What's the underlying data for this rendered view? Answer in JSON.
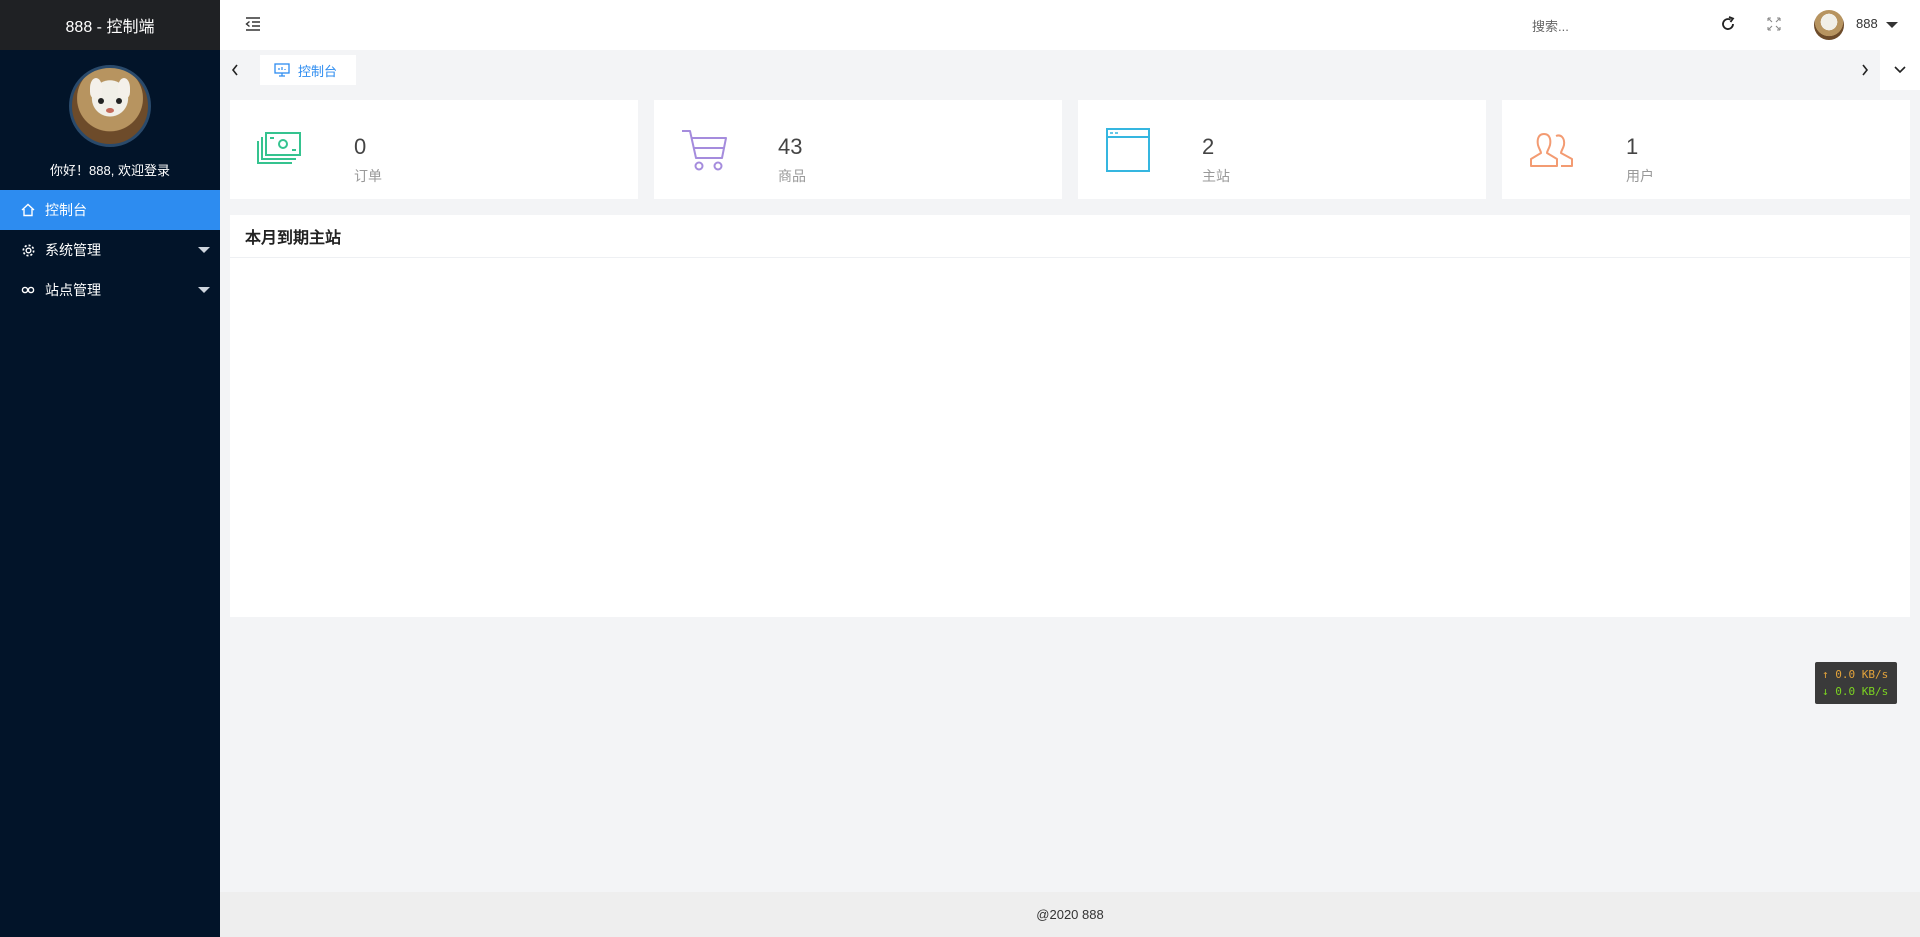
{
  "brand": {
    "title": "888 - 控制端"
  },
  "profile": {
    "welcome": "你好！888, 欢迎登录"
  },
  "sidebar": {
    "items": [
      {
        "label": "控制台",
        "icon": "home-icon",
        "active": true
      },
      {
        "label": "系统管理",
        "icon": "gear-icon",
        "expandable": true
      },
      {
        "label": "站点管理",
        "icon": "infinity-icon",
        "expandable": true
      }
    ]
  },
  "header": {
    "search_placeholder": "搜索...",
    "username": "888"
  },
  "tabs": [
    {
      "label": "控制台",
      "icon": "monitor-icon",
      "active": true
    }
  ],
  "stats": [
    {
      "value": "0",
      "label": "订单",
      "icon": "money-icon",
      "color": "#35c38f"
    },
    {
      "value": "43",
      "label": "商品",
      "icon": "cart-icon",
      "color": "#a58cdd"
    },
    {
      "value": "2",
      "label": "主站",
      "icon": "browser-window-icon",
      "color": "#35b6e0"
    },
    {
      "value": "1",
      "label": "用户",
      "icon": "users-icon",
      "color": "#f39b72"
    }
  ],
  "panel": {
    "title": "本月到期主站"
  },
  "network_speed": {
    "up": "↑ 0.0 KB/s",
    "down": "↓ 0.0 KB/s"
  },
  "footer": {
    "text": "@2020 888"
  },
  "colors": {
    "sidebar_bg": "#021429",
    "accent": "#2d8cf0",
    "brand_bg": "#1f2124"
  }
}
